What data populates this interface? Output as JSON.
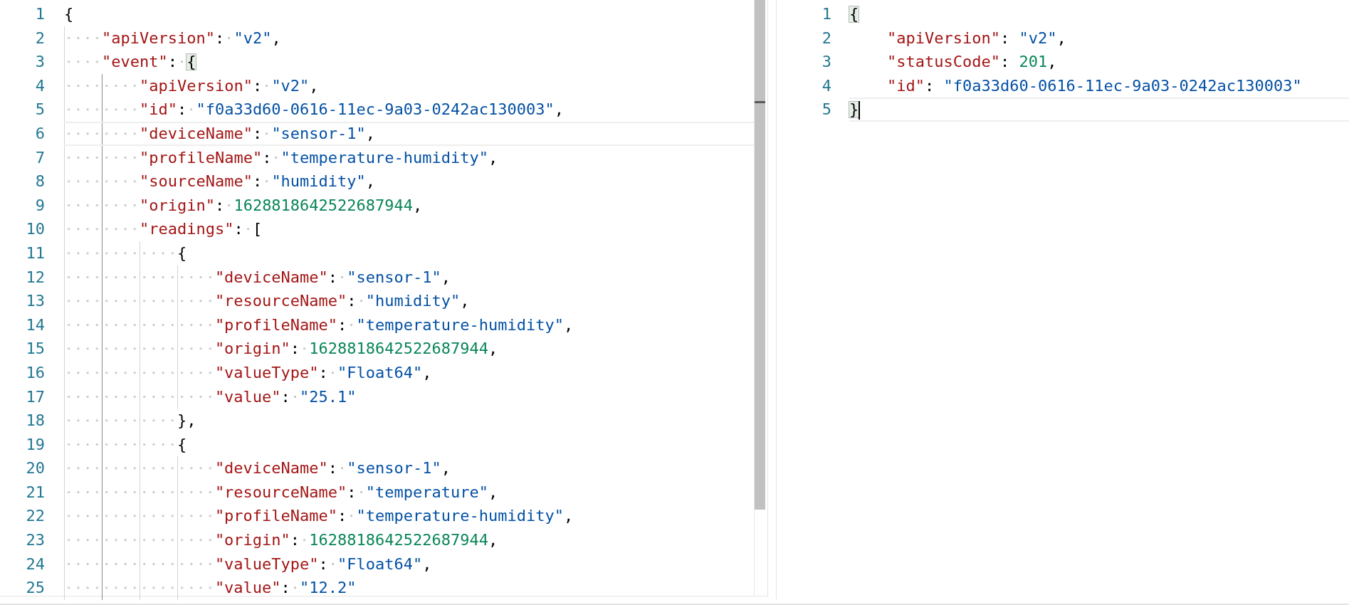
{
  "editors": [
    {
      "render_whitespace": true,
      "focused": false,
      "scrollbar": true,
      "lines": [
        {
          "number": "1",
          "current": false,
          "tokens": [
            {
              "kind": "punct",
              "text": "{"
            }
          ]
        },
        {
          "number": "2",
          "current": false,
          "indent": [
            {
              "kind": "guide",
              "active": false
            }
          ],
          "tokens": [
            {
              "kind": "key",
              "text": "\"apiVersion\""
            },
            {
              "kind": "colon",
              "text": ":"
            },
            {
              "kind": "string",
              "text": "\"v2\""
            },
            {
              "kind": "punct",
              "text": ","
            }
          ]
        },
        {
          "number": "3",
          "current": false,
          "indent": [
            {
              "kind": "guide",
              "active": false
            }
          ],
          "tokens": [
            {
              "kind": "key",
              "text": "\"event\""
            },
            {
              "kind": "colon",
              "text": ":"
            },
            {
              "kind": "bracket",
              "text": "{",
              "matched": true
            }
          ]
        },
        {
          "number": "4",
          "current": false,
          "indent": [
            {
              "kind": "guide",
              "active": false
            },
            {
              "kind": "guide",
              "active": true
            }
          ],
          "tokens": [
            {
              "kind": "key",
              "text": "\"apiVersion\""
            },
            {
              "kind": "colon",
              "text": ":"
            },
            {
              "kind": "string",
              "text": "\"v2\""
            },
            {
              "kind": "punct",
              "text": ","
            }
          ]
        },
        {
          "number": "5",
          "current": false,
          "indent": [
            {
              "kind": "guide",
              "active": false
            },
            {
              "kind": "guide",
              "active": true
            }
          ],
          "tokens": [
            {
              "kind": "key",
              "text": "\"id\""
            },
            {
              "kind": "colon",
              "text": ":"
            },
            {
              "kind": "string",
              "text": "\"f0a33d60-0616-11ec-9a03-0242ac130003\""
            },
            {
              "kind": "punct",
              "text": ","
            }
          ]
        },
        {
          "number": "6",
          "current": true,
          "indent": [
            {
              "kind": "guide",
              "active": false
            },
            {
              "kind": "guide",
              "active": true
            }
          ],
          "tokens": [
            {
              "kind": "key",
              "text": "\"deviceName\""
            },
            {
              "kind": "colon",
              "text": ":"
            },
            {
              "kind": "string",
              "text": "\"sensor-1\""
            },
            {
              "kind": "punct",
              "text": ","
            }
          ]
        },
        {
          "number": "7",
          "current": false,
          "indent": [
            {
              "kind": "guide",
              "active": false
            },
            {
              "kind": "guide",
              "active": true
            }
          ],
          "tokens": [
            {
              "kind": "key",
              "text": "\"profileName\""
            },
            {
              "kind": "colon",
              "text": ":"
            },
            {
              "kind": "string",
              "text": "\"temperature-humidity\""
            },
            {
              "kind": "punct",
              "text": ","
            }
          ]
        },
        {
          "number": "8",
          "current": false,
          "indent": [
            {
              "kind": "guide",
              "active": false
            },
            {
              "kind": "guide",
              "active": true
            }
          ],
          "tokens": [
            {
              "kind": "key",
              "text": "\"sourceName\""
            },
            {
              "kind": "colon",
              "text": ":"
            },
            {
              "kind": "string",
              "text": "\"humidity\""
            },
            {
              "kind": "punct",
              "text": ","
            }
          ]
        },
        {
          "number": "9",
          "current": false,
          "indent": [
            {
              "kind": "guide",
              "active": false
            },
            {
              "kind": "guide",
              "active": true
            }
          ],
          "tokens": [
            {
              "kind": "key",
              "text": "\"origin\""
            },
            {
              "kind": "colon",
              "text": ":"
            },
            {
              "kind": "number",
              "text": "1628818642522687944"
            },
            {
              "kind": "punct",
              "text": ","
            }
          ]
        },
        {
          "number": "10",
          "current": false,
          "indent": [
            {
              "kind": "guide",
              "active": false
            },
            {
              "kind": "guide",
              "active": true
            }
          ],
          "tokens": [
            {
              "kind": "key",
              "text": "\"readings\""
            },
            {
              "kind": "colon",
              "text": ":"
            },
            {
              "kind": "punct",
              "text": "["
            }
          ]
        },
        {
          "number": "11",
          "current": false,
          "indent": [
            {
              "kind": "guide",
              "active": false
            },
            {
              "kind": "guide",
              "active": true
            },
            {
              "kind": "guide",
              "active": false
            }
          ],
          "tokens": [
            {
              "kind": "punct",
              "text": "{"
            }
          ]
        },
        {
          "number": "12",
          "current": false,
          "indent": [
            {
              "kind": "guide",
              "active": false
            },
            {
              "kind": "guide",
              "active": true
            },
            {
              "kind": "guide",
              "active": false
            },
            {
              "kind": "guide",
              "active": false
            }
          ],
          "tokens": [
            {
              "kind": "key",
              "text": "\"deviceName\""
            },
            {
              "kind": "colon",
              "text": ":"
            },
            {
              "kind": "string",
              "text": "\"sensor-1\""
            },
            {
              "kind": "punct",
              "text": ","
            }
          ]
        },
        {
          "number": "13",
          "current": false,
          "indent": [
            {
              "kind": "guide",
              "active": false
            },
            {
              "kind": "guide",
              "active": true
            },
            {
              "kind": "guide",
              "active": false
            },
            {
              "kind": "guide",
              "active": false
            }
          ],
          "tokens": [
            {
              "kind": "key",
              "text": "\"resourceName\""
            },
            {
              "kind": "colon",
              "text": ":"
            },
            {
              "kind": "string",
              "text": "\"humidity\""
            },
            {
              "kind": "punct",
              "text": ","
            }
          ]
        },
        {
          "number": "14",
          "current": false,
          "indent": [
            {
              "kind": "guide",
              "active": false
            },
            {
              "kind": "guide",
              "active": true
            },
            {
              "kind": "guide",
              "active": false
            },
            {
              "kind": "guide",
              "active": false
            }
          ],
          "tokens": [
            {
              "kind": "key",
              "text": "\"profileName\""
            },
            {
              "kind": "colon",
              "text": ":"
            },
            {
              "kind": "string",
              "text": "\"temperature-humidity\""
            },
            {
              "kind": "punct",
              "text": ","
            }
          ]
        },
        {
          "number": "15",
          "current": false,
          "indent": [
            {
              "kind": "guide",
              "active": false
            },
            {
              "kind": "guide",
              "active": true
            },
            {
              "kind": "guide",
              "active": false
            },
            {
              "kind": "guide",
              "active": false
            }
          ],
          "tokens": [
            {
              "kind": "key",
              "text": "\"origin\""
            },
            {
              "kind": "colon",
              "text": ":"
            },
            {
              "kind": "number",
              "text": "1628818642522687944"
            },
            {
              "kind": "punct",
              "text": ","
            }
          ]
        },
        {
          "number": "16",
          "current": false,
          "indent": [
            {
              "kind": "guide",
              "active": false
            },
            {
              "kind": "guide",
              "active": true
            },
            {
              "kind": "guide",
              "active": false
            },
            {
              "kind": "guide",
              "active": false
            }
          ],
          "tokens": [
            {
              "kind": "key",
              "text": "\"valueType\""
            },
            {
              "kind": "colon",
              "text": ":"
            },
            {
              "kind": "string",
              "text": "\"Float64\""
            },
            {
              "kind": "punct",
              "text": ","
            }
          ]
        },
        {
          "number": "17",
          "current": false,
          "indent": [
            {
              "kind": "guide",
              "active": false
            },
            {
              "kind": "guide",
              "active": true
            },
            {
              "kind": "guide",
              "active": false
            },
            {
              "kind": "guide",
              "active": false
            }
          ],
          "tokens": [
            {
              "kind": "key",
              "text": "\"value\""
            },
            {
              "kind": "colon",
              "text": ":"
            },
            {
              "kind": "string",
              "text": "\"25.1\""
            }
          ]
        },
        {
          "number": "18",
          "current": false,
          "indent": [
            {
              "kind": "guide",
              "active": false
            },
            {
              "kind": "guide",
              "active": true
            },
            {
              "kind": "guide",
              "active": false
            }
          ],
          "tokens": [
            {
              "kind": "punct",
              "text": "},"
            }
          ]
        },
        {
          "number": "19",
          "current": false,
          "indent": [
            {
              "kind": "guide",
              "active": false
            },
            {
              "kind": "guide",
              "active": true
            },
            {
              "kind": "guide",
              "active": false
            }
          ],
          "tokens": [
            {
              "kind": "punct",
              "text": "{"
            }
          ]
        },
        {
          "number": "20",
          "current": false,
          "indent": [
            {
              "kind": "guide",
              "active": false
            },
            {
              "kind": "guide",
              "active": true
            },
            {
              "kind": "guide",
              "active": false
            },
            {
              "kind": "guide",
              "active": false
            }
          ],
          "tokens": [
            {
              "kind": "key",
              "text": "\"deviceName\""
            },
            {
              "kind": "colon",
              "text": ":"
            },
            {
              "kind": "string",
              "text": "\"sensor-1\""
            },
            {
              "kind": "punct",
              "text": ","
            }
          ]
        },
        {
          "number": "21",
          "current": false,
          "indent": [
            {
              "kind": "guide",
              "active": false
            },
            {
              "kind": "guide",
              "active": true
            },
            {
              "kind": "guide",
              "active": false
            },
            {
              "kind": "guide",
              "active": false
            }
          ],
          "tokens": [
            {
              "kind": "key",
              "text": "\"resourceName\""
            },
            {
              "kind": "colon",
              "text": ":"
            },
            {
              "kind": "string",
              "text": "\"temperature\""
            },
            {
              "kind": "punct",
              "text": ","
            }
          ]
        },
        {
          "number": "22",
          "current": false,
          "indent": [
            {
              "kind": "guide",
              "active": false
            },
            {
              "kind": "guide",
              "active": true
            },
            {
              "kind": "guide",
              "active": false
            },
            {
              "kind": "guide",
              "active": false
            }
          ],
          "tokens": [
            {
              "kind": "key",
              "text": "\"profileName\""
            },
            {
              "kind": "colon",
              "text": ":"
            },
            {
              "kind": "string",
              "text": "\"temperature-humidity\""
            },
            {
              "kind": "punct",
              "text": ","
            }
          ]
        },
        {
          "number": "23",
          "current": false,
          "indent": [
            {
              "kind": "guide",
              "active": false
            },
            {
              "kind": "guide",
              "active": true
            },
            {
              "kind": "guide",
              "active": false
            },
            {
              "kind": "guide",
              "active": false
            }
          ],
          "tokens": [
            {
              "kind": "key",
              "text": "\"origin\""
            },
            {
              "kind": "colon",
              "text": ":"
            },
            {
              "kind": "number",
              "text": "1628818642522687944"
            },
            {
              "kind": "punct",
              "text": ","
            }
          ]
        },
        {
          "number": "24",
          "current": false,
          "indent": [
            {
              "kind": "guide",
              "active": false
            },
            {
              "kind": "guide",
              "active": true
            },
            {
              "kind": "guide",
              "active": false
            },
            {
              "kind": "guide",
              "active": false
            }
          ],
          "tokens": [
            {
              "kind": "key",
              "text": "\"valueType\""
            },
            {
              "kind": "colon",
              "text": ":"
            },
            {
              "kind": "string",
              "text": "\"Float64\""
            },
            {
              "kind": "punct",
              "text": ","
            }
          ]
        },
        {
          "number": "25",
          "current": false,
          "indent": [
            {
              "kind": "guide",
              "active": false
            },
            {
              "kind": "guide",
              "active": true
            },
            {
              "kind": "guide",
              "active": false
            },
            {
              "kind": "guide",
              "active": false
            }
          ],
          "tokens": [
            {
              "kind": "key",
              "text": "\"value\""
            },
            {
              "kind": "colon",
              "text": ":"
            },
            {
              "kind": "string",
              "text": "\"12.2\""
            }
          ]
        }
      ]
    },
    {
      "render_whitespace": false,
      "focused": true,
      "lines": [
        {
          "number": "1",
          "current": false,
          "tokens": [
            {
              "kind": "bracket",
              "text": "{",
              "matched": true
            }
          ]
        },
        {
          "number": "2",
          "current": false,
          "indent": [
            {
              "kind": "blank"
            }
          ],
          "tokens": [
            {
              "kind": "key",
              "text": "\"apiVersion\""
            },
            {
              "kind": "colon",
              "text": ":"
            },
            {
              "kind": "string",
              "text": "\"v2\""
            },
            {
              "kind": "punct",
              "text": ","
            }
          ]
        },
        {
          "number": "3",
          "current": false,
          "indent": [
            {
              "kind": "blank"
            }
          ],
          "tokens": [
            {
              "kind": "key",
              "text": "\"statusCode\""
            },
            {
              "kind": "colon",
              "text": ":"
            },
            {
              "kind": "number",
              "text": "201"
            },
            {
              "kind": "punct",
              "text": ","
            }
          ]
        },
        {
          "number": "4",
          "current": false,
          "indent": [
            {
              "kind": "blank"
            }
          ],
          "tokens": [
            {
              "kind": "key",
              "text": "\"id\""
            },
            {
              "kind": "colon",
              "text": ":"
            },
            {
              "kind": "string",
              "text": "\"f0a33d60-0616-11ec-9a03-0242ac130003\""
            }
          ]
        },
        {
          "number": "5",
          "current": true,
          "tokens": [
            {
              "kind": "bracket",
              "text": "}",
              "matched": true
            }
          ]
        }
      ]
    }
  ]
}
